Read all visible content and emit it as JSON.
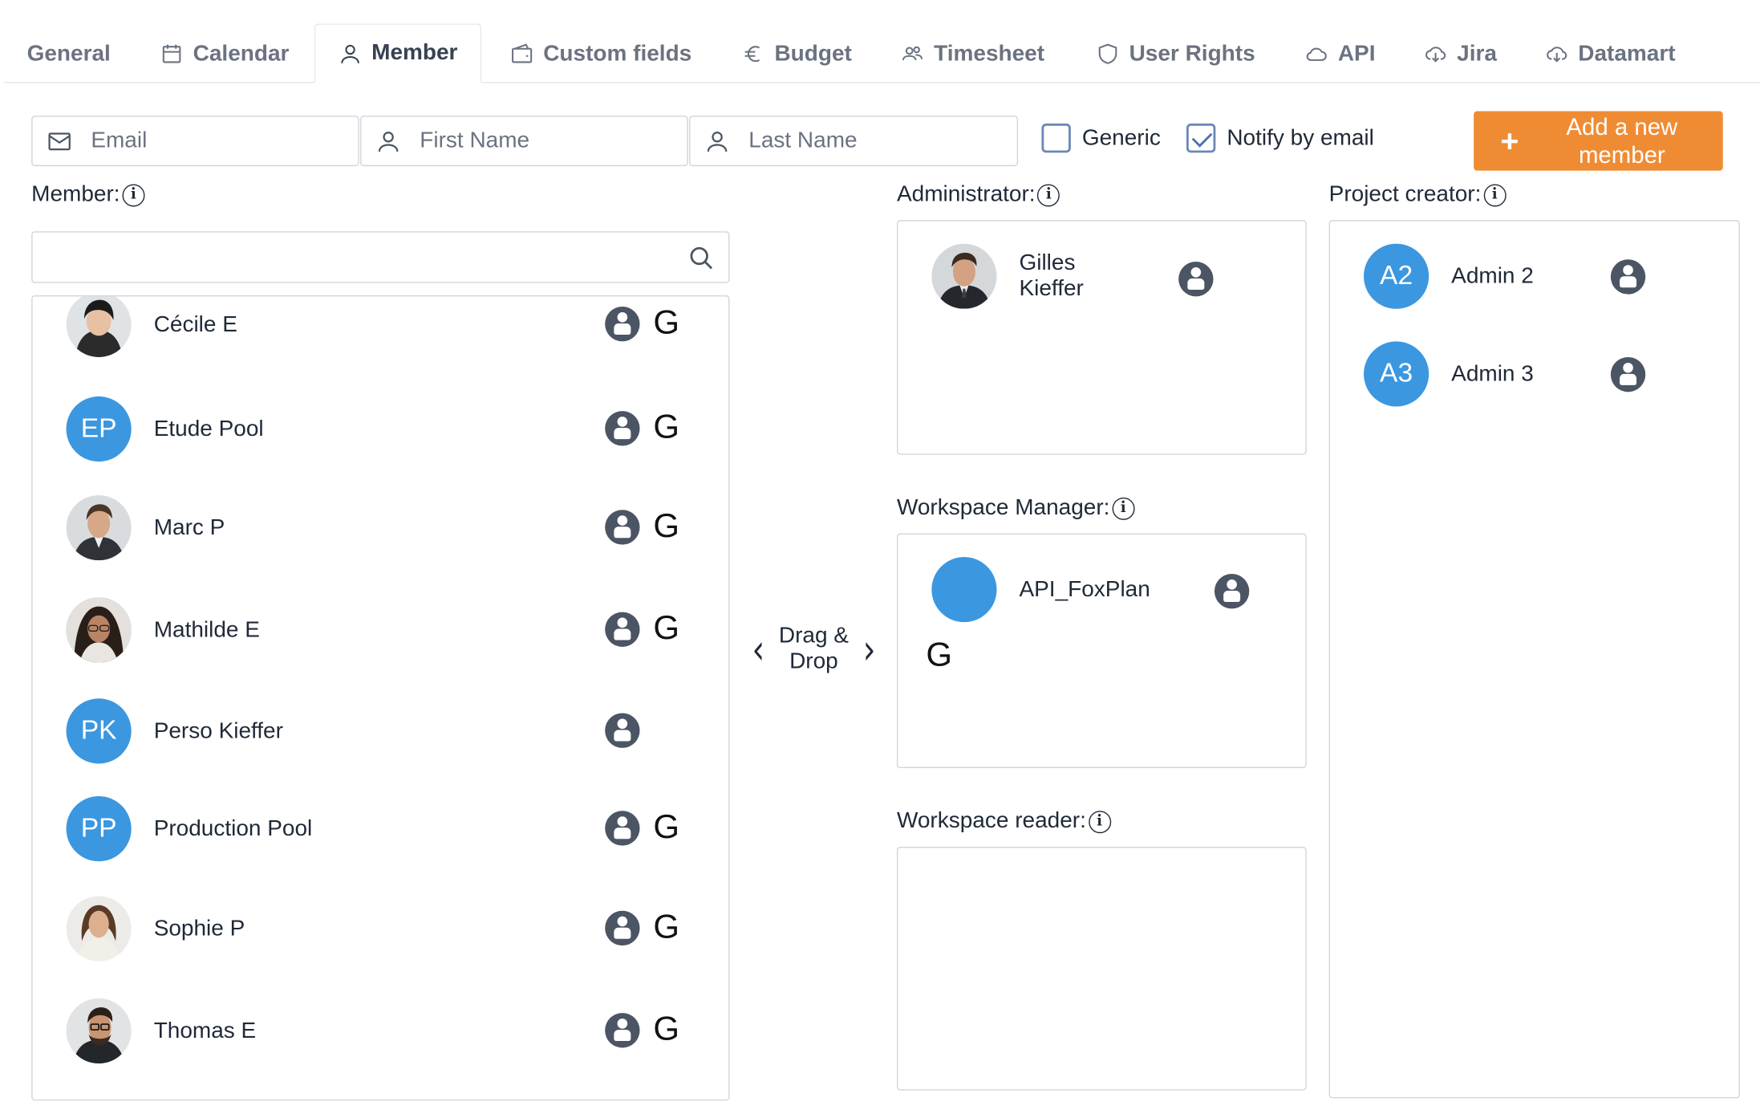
{
  "tabs": [
    {
      "label": "General",
      "icon": "none"
    },
    {
      "label": "Calendar",
      "icon": "calendar-icon"
    },
    {
      "label": "Member",
      "icon": "user-icon",
      "active": true
    },
    {
      "label": "Custom fields",
      "icon": "wallet-icon"
    },
    {
      "label": "Budget",
      "icon": "euro-icon"
    },
    {
      "label": "Timesheet",
      "icon": "users-icon"
    },
    {
      "label": "User Rights",
      "icon": "shield-icon"
    },
    {
      "label": "API",
      "icon": "cloud-icon"
    },
    {
      "label": "Jira",
      "icon": "cloud-download-icon"
    },
    {
      "label": "Datamart",
      "icon": "cloud-download-icon"
    }
  ],
  "form": {
    "email_placeholder": "Email",
    "first_name_placeholder": "First Name",
    "last_name_placeholder": "Last Name",
    "generic_label": "Generic",
    "generic_checked": false,
    "notify_label": "Notify by email",
    "notify_checked": true,
    "add_button_label": "Add a new member"
  },
  "labels": {
    "member": "Member:",
    "administrator": "Administrator:",
    "workspace_manager": "Workspace Manager:",
    "workspace_reader": "Workspace reader:",
    "project_creator": "Project creator:",
    "info_glyph": "i",
    "drag_drop": "Drag & Drop"
  },
  "search": {
    "value": "",
    "placeholder": ""
  },
  "members": [
    {
      "name": "Cécile E",
      "avatar": "photo",
      "generic": "G"
    },
    {
      "name": "Etude Pool",
      "avatar": "EP",
      "generic": "G"
    },
    {
      "name": "Marc P",
      "avatar": "photo",
      "generic": "G"
    },
    {
      "name": "Mathilde E",
      "avatar": "photo",
      "generic": "G"
    },
    {
      "name": "Perso Kieffer",
      "avatar": "PK",
      "generic": ""
    },
    {
      "name": "Production Pool",
      "avatar": "PP",
      "generic": "G"
    },
    {
      "name": "Sophie P",
      "avatar": "photo",
      "generic": "G"
    },
    {
      "name": "Thomas E",
      "avatar": "photo",
      "generic": "G"
    }
  ],
  "administrators": [
    {
      "name": "Gilles Kieffer",
      "avatar": "photo"
    }
  ],
  "workspace_managers": [
    {
      "name": "API_FoxPlan",
      "avatar": "",
      "generic": "G"
    }
  ],
  "project_creators": [
    {
      "name": "Admin 2",
      "avatar": "A2"
    },
    {
      "name": "Admin 3",
      "avatar": "A3"
    }
  ],
  "colors": {
    "accent_orange": "#ef8c33",
    "avatar_blue": "#3b97e0",
    "role_icon_gray": "#4b5563",
    "checkbox_blue": "#6b87b8"
  }
}
